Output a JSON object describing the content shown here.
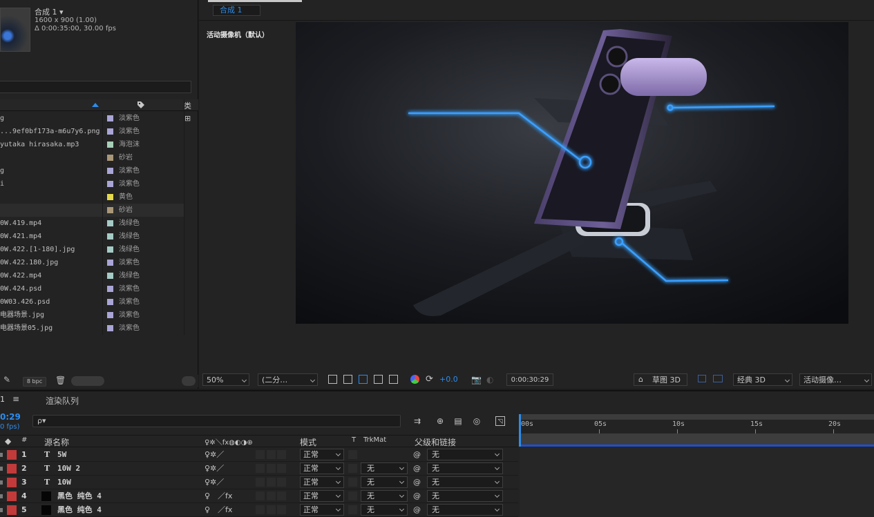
{
  "project": {
    "comp_name": "合成 1 ▾",
    "comp_res": "1600 x 900 (1.00)",
    "comp_dur": "Δ 0:00:35:00, 30.00 fps",
    "col_type": "类",
    "items": [
      {
        "name": "g",
        "label": "淡紫色",
        "color": "#a9a5d6"
      },
      {
        "name": "...9ef0bf173a-m6u7y6.png",
        "label": "淡紫色",
        "color": "#a9a5d6"
      },
      {
        "name": "yutaka hirasaka.mp3",
        "label": "海泡沫",
        "color": "#a7d0b8"
      },
      {
        "name": "",
        "label": "砂岩",
        "color": "#a99778"
      },
      {
        "name": "g",
        "label": "淡紫色",
        "color": "#a9a5d6"
      },
      {
        "name": "i",
        "label": "淡紫色",
        "color": "#a9a5d6"
      },
      {
        "name": "",
        "label": "黄色",
        "color": "#e4d84c"
      },
      {
        "name": "",
        "label": "砂岩",
        "color": "#a99778"
      },
      {
        "name": "0W.419.mp4",
        "label": "浅绿色",
        "color": "#a5cbc6"
      },
      {
        "name": "0W.421.mp4",
        "label": "浅绿色",
        "color": "#a5cbc6"
      },
      {
        "name": "0W.422.[1-180].jpg",
        "label": "浅绿色",
        "color": "#a5cbc6"
      },
      {
        "name": "0W.422.180.jpg",
        "label": "淡紫色",
        "color": "#a9a5d6"
      },
      {
        "name": "0W.422.mp4",
        "label": "浅绿色",
        "color": "#a5cbc6"
      },
      {
        "name": "0W.424.psd",
        "label": "淡紫色",
        "color": "#a9a5d6"
      },
      {
        "name": "0W03.426.psd",
        "label": "淡紫色",
        "color": "#a9a5d6"
      },
      {
        "name": "电器场景.jpg",
        "label": "淡紫色",
        "color": "#a9a5d6"
      },
      {
        "name": "电器场景05.jpg",
        "label": "淡紫色",
        "color": "#a9a5d6"
      }
    ],
    "selected_index": 7,
    "bpc": "8 bpc"
  },
  "viewer": {
    "tab": "合成 1",
    "camera_label": "活动摄像机（默认）",
    "zoom": "50%",
    "resolution": "(二分…",
    "exposure": "+0.0",
    "timecode": "0:00:30:29",
    "draft3d": "草图 3D",
    "renderer": "经典 3D",
    "camera_view": "活动摄像…"
  },
  "timeline": {
    "tab_comp": "1",
    "tab_render": "渲染队列",
    "time": "0:29",
    "fps": "0 fps)",
    "search_placeholder": "ρ▾",
    "ruler": [
      "00s",
      "05s",
      "10s",
      "15s",
      "20s"
    ],
    "headers": {
      "num": "#",
      "source": "源名称",
      "mode": "模式",
      "t": "T",
      "trkmat": "TrkMat",
      "parent": "父级和链接"
    },
    "layers": [
      {
        "num": "1",
        "kind": "text",
        "name": "5W",
        "mode": "正常",
        "trkmat": "",
        "parent": "无"
      },
      {
        "num": "2",
        "kind": "text",
        "name": "10W 2",
        "mode": "正常",
        "trkmat": "无",
        "parent": "无"
      },
      {
        "num": "3",
        "kind": "text",
        "name": "10W",
        "mode": "正常",
        "trkmat": "无",
        "parent": "无"
      },
      {
        "num": "4",
        "kind": "solid",
        "name": "黑色 纯色 4",
        "mode": "正常",
        "trkmat": "无",
        "parent": "无"
      },
      {
        "num": "5",
        "kind": "solid",
        "name": "黑色 纯色 4",
        "mode": "正常",
        "trkmat": "无",
        "parent": "无"
      }
    ]
  },
  "colors": {
    "accent": "#2d8ceb",
    "label_red": "#c23a3a",
    "glow": "#3aa0ff"
  }
}
